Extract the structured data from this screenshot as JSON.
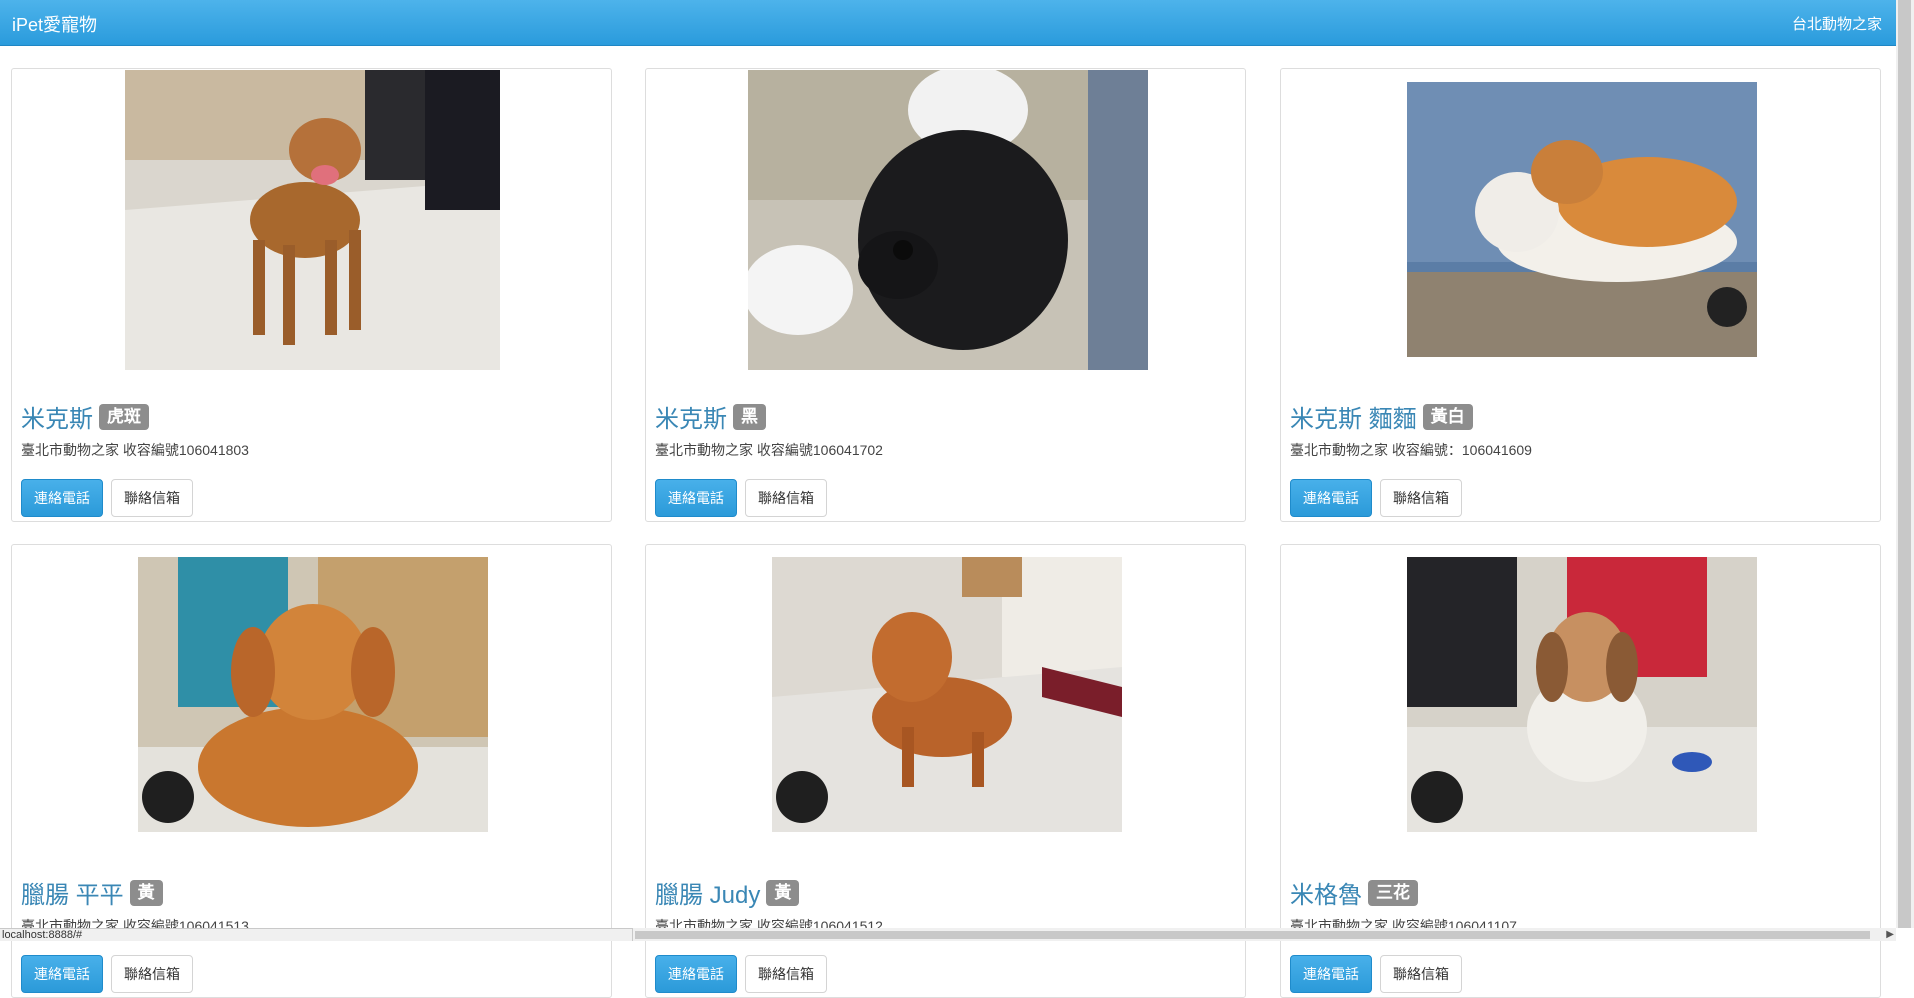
{
  "navbar": {
    "brand": "iPet愛寵物",
    "right_link": "台北動物之家"
  },
  "pets": [
    {
      "name": "米克斯",
      "color_badge": "虎斑",
      "info": "臺北市動物之家 收容編號106041803",
      "phone_label": "連絡電話",
      "email_label": "聯絡信箱",
      "photo_icon": "dog-photo"
    },
    {
      "name": "米克斯",
      "color_badge": "黑",
      "info": "臺北市動物之家 收容編號106041702",
      "phone_label": "連絡電話",
      "email_label": "聯絡信箱",
      "photo_icon": "dog-photo"
    },
    {
      "name": "米克斯 麵麵",
      "color_badge": "黃白",
      "info": "臺北市動物之家 收容編號：106041609",
      "phone_label": "連絡電話",
      "email_label": "聯絡信箱",
      "photo_icon": "cat-photo"
    },
    {
      "name": "臘腸 平平",
      "color_badge": "黃",
      "info": "臺北市動物之家 收容編號106041513",
      "phone_label": "連絡電話",
      "email_label": "聯絡信箱",
      "photo_icon": "dog-photo"
    },
    {
      "name": "臘腸 Judy",
      "color_badge": "黃",
      "info": "臺北市動物之家 收容編號106041512",
      "phone_label": "連絡電話",
      "email_label": "聯絡信箱",
      "photo_icon": "dog-photo"
    },
    {
      "name": "米格魯",
      "color_badge": "三花",
      "info": "臺北市動物之家 收容編號106041107",
      "phone_label": "連絡電話",
      "email_label": "聯絡信箱",
      "photo_icon": "dog-photo"
    }
  ],
  "statusbar": {
    "url": "localhost:8888/#"
  },
  "colors": {
    "navbar": "#3aa6e4",
    "pet_name": "#3a87b5",
    "badge": "#8d8d8d",
    "primary_button": "#2b9ad9"
  }
}
